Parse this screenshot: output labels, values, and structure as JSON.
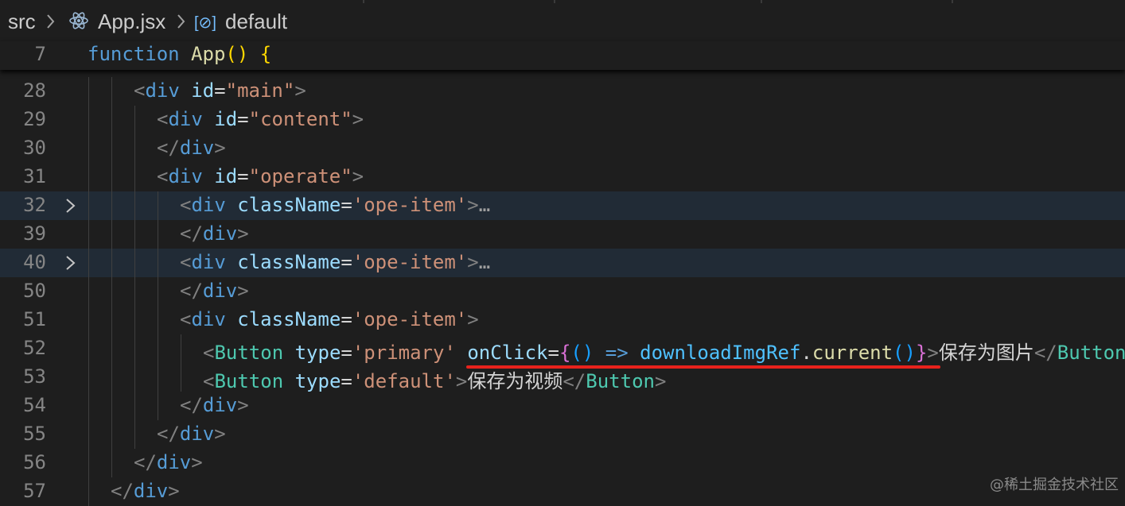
{
  "breadcrumb": {
    "folder": "src",
    "file": "App.jsx",
    "symbol_icon": "[⊘]",
    "symbol": "default",
    "separator": ">"
  },
  "sticky": {
    "line_number": "7",
    "keyword": "function",
    "name": "App",
    "parens": "()",
    "brace": "{"
  },
  "lines": [
    {
      "n": "28",
      "tag": "div",
      "attr": "id",
      "val": "\"main\""
    },
    {
      "n": "29",
      "tag": "div",
      "attr": "id",
      "val": "\"content\""
    },
    {
      "n": "30",
      "close": "div"
    },
    {
      "n": "31",
      "tag": "div",
      "attr": "id",
      "val": "\"operate\""
    },
    {
      "n": "32",
      "tag": "div",
      "attr": "className",
      "val": "'ope-item'",
      "ellipsis": "…"
    },
    {
      "n": "39",
      "close": "div"
    },
    {
      "n": "40",
      "tag": "div",
      "attr": "className",
      "val": "'ope-item'",
      "ellipsis": "…"
    },
    {
      "n": "50",
      "close": "div"
    },
    {
      "n": "51",
      "tag": "div",
      "attr": "className",
      "val": "'ope-item'"
    },
    {
      "n": "52",
      "comp": "Button",
      "attr": "type",
      "val": "'primary'",
      "attr2": "onClick",
      "arrow": "=>",
      "ref": "downloadImgRef",
      "prop": "current",
      "text": "保存为图片",
      "close": "Button"
    },
    {
      "n": "53",
      "comp": "Button",
      "attr": "type",
      "val": "'default'",
      "text": "保存为视频",
      "close": "Button"
    },
    {
      "n": "54",
      "close": "div"
    },
    {
      "n": "55",
      "close": "div"
    },
    {
      "n": "56",
      "close": "div"
    },
    {
      "n": "57",
      "close": "div"
    }
  ],
  "watermark": "@稀土掘金技术社区"
}
